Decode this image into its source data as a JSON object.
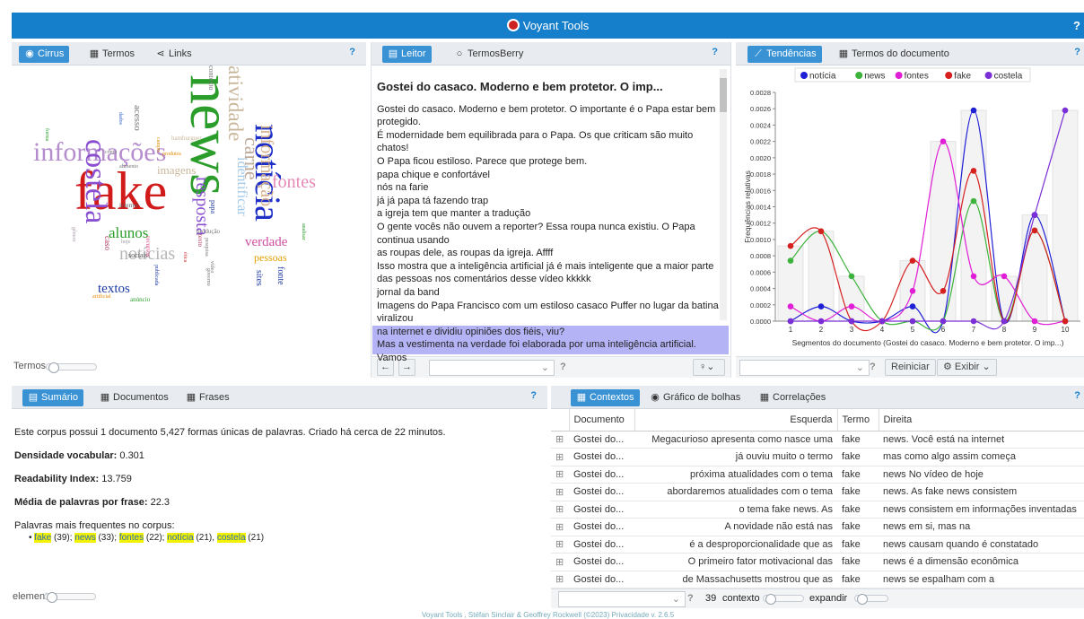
{
  "app": {
    "title": "Voyant Tools",
    "help": "?"
  },
  "cirrus": {
    "tabs": [
      "Cirrus",
      "Termos",
      "Links"
    ],
    "help": "?",
    "footer_label": "Termos",
    "words": [
      "news",
      "fake",
      "informações",
      "costela",
      "notícia",
      "fontes",
      "atividade",
      "carne",
      "informação",
      "notícias",
      "textos",
      "resposta",
      "identificar",
      "verdade",
      "pessoas",
      "imagens",
      "alunos",
      "fonte",
      "sites",
      "acesso",
      "sociais",
      "internet",
      "conta",
      "hamburguer",
      "produção",
      "caso",
      "texto",
      "vídeo",
      "ética",
      "artificial",
      "anúncio",
      "publicada",
      "recursos",
      "pesquisa",
      "hoje",
      "contexto",
      "analisar",
      "campo",
      "gênero",
      "produtos",
      "alimento",
      "governo",
      "dados",
      "forma",
      "papa"
    ]
  },
  "reader": {
    "tabs": [
      "Leitor",
      "TermosBerry"
    ],
    "help": "?",
    "title": "Gostei do casaco. Moderno e bem protetor. O imp...",
    "lines": [
      "Gostei do casaco. Moderno e bem protetor. O importante é o Papa estar bem",
      "protegido.",
      "É modernidade bem equilibrada para o Papa. Os que criticam são muito chatos!",
      "O Papa ficou estiloso. Parece que protege bem.",
      "papa chique e confortável",
      "nós na farie",
      "já já papa tá fazendo trap",
      "a igreja tem que manter a tradução",
      "O gente vocês não ouvem a reporter? Essa roupa nunca existiu. O Papa",
      "continua usando",
      "as roupas dele, as roupas da igreja. Affff",
      "Isso mostra que a inteligência artificial já é mais inteligente que a maior parte",
      "das pessoas nos comentários desse vídeo kkkkk",
      "jornal da band",
      "Imagens do Papa Francisco com um estiloso casaco Puffer no lugar da batina",
      "viralizou",
      "na internet e dividiu opiniões dos fiéis, viu?",
      "Mas a vestimenta na verdade foi elaborada por uma inteligência artificial. Vamos"
    ],
    "help_small": "?"
  },
  "trends": {
    "tabs": [
      "Tendências",
      "Termos do documento"
    ],
    "help": "?",
    "reset_label": "Reiniciar",
    "show_label": "Exibir",
    "combo_help": "?"
  },
  "chart_data": {
    "type": "line",
    "ylabel": "Frequências relativas",
    "xlabel": "Segmentos do documento (Gostei do casaco. Moderno e bem protetor. O imp...)",
    "x": [
      1,
      2,
      3,
      4,
      5,
      6,
      7,
      8,
      9,
      10
    ],
    "ylim": [
      0,
      0.0028
    ],
    "yticks": [
      "0.0000",
      "0.0002",
      "0.0004",
      "0.0006",
      "0.0008",
      "0.0010",
      "0.0012",
      "0.0014",
      "0.0016",
      "0.0018",
      "0.0020",
      "0.0022",
      "0.0024",
      "0.0026",
      "0.0028"
    ],
    "legend_position": "top",
    "series": [
      {
        "name": "notícia",
        "color": "#1f1fd6",
        "values": [
          0.0,
          0.00018,
          0.0,
          0.0,
          0.00018,
          0.0,
          0.00258,
          0.0,
          0.0013,
          0.0
        ]
      },
      {
        "name": "news",
        "color": "#3db33d",
        "values": [
          0.00074,
          0.0011,
          0.00055,
          0.0,
          0.0,
          0.0,
          0.00147,
          0.0,
          0.00111,
          0.0
        ]
      },
      {
        "name": "fontes",
        "color": "#e01ed6",
        "values": [
          0.00018,
          0.0,
          0.00018,
          0.0,
          0.00037,
          0.0022,
          0.00055,
          0.00055,
          0.0,
          0.0
        ]
      },
      {
        "name": "fake",
        "color": "#d62020",
        "values": [
          0.00092,
          0.0011,
          0.0,
          0.0,
          0.00074,
          0.00037,
          0.00184,
          0.0,
          0.00111,
          0.0
        ]
      },
      {
        "name": "costela",
        "color": "#7b2fd6",
        "values": [
          0.0,
          0.0,
          0.0,
          0.0,
          0.0,
          0.0,
          0.0,
          0.0,
          0.0013,
          0.00258
        ]
      }
    ]
  },
  "summary": {
    "tabs": [
      "Sumário",
      "Documentos",
      "Frases"
    ],
    "help": "?",
    "intro": "Este corpus possui 1 documento 5,427 formas únicas de palavras. Criado há cerca de 22 minutos.",
    "density_label": "Densidade vocabular:",
    "density_value": "0.301",
    "readability_label": "Readability Index:",
    "readability_value": "13.759",
    "avg_label": "Média de palavras por frase:",
    "avg_value": "22.3",
    "freq_label": "Palavras mais frequentes no corpus:",
    "freq": [
      {
        "w": "fake",
        "c": "(39)"
      },
      {
        "w": "news",
        "c": "(33)"
      },
      {
        "w": "fontes",
        "c": "(22)"
      },
      {
        "w": "notícia",
        "c": "(21)"
      },
      {
        "w": "costela",
        "c": "(21)"
      }
    ],
    "footer_label": "element"
  },
  "contexts": {
    "tabs": [
      "Contextos",
      "Gráfico de bolhas",
      "Correlações"
    ],
    "help": "?",
    "columns": [
      "Documento",
      "Esquerda",
      "Termo",
      "Direita"
    ],
    "rows": [
      [
        "Gostei do...",
        "Megacurioso apresenta como nasce uma",
        "fake",
        "news. Você está na internet"
      ],
      [
        "Gostei do...",
        "já ouviu muito o termo",
        "fake",
        "mas como algo assim começa"
      ],
      [
        "Gostei do...",
        "próxima atualidades com o tema",
        "fake",
        "news No vídeo de hoje"
      ],
      [
        "Gostei do...",
        "abordaremos atualidades com o tema",
        "fake",
        "news. As fake news consistem"
      ],
      [
        "Gostei do...",
        "o tema fake news. As",
        "fake",
        "news consistem em informações inventadas"
      ],
      [
        "Gostei do...",
        "A novidade não está nas",
        "fake",
        "news em si, mas na"
      ],
      [
        "Gostei do...",
        "é a desproporcionalidade que as",
        "fake",
        "news causam quando é constatado"
      ],
      [
        "Gostei do...",
        "O primeiro fator motivacional das",
        "fake",
        "news é a dimensão econômica"
      ],
      [
        "Gostei do...",
        "de Massachusetts mostrou que as",
        "fake",
        "news se espalham com a"
      ]
    ],
    "count": "39",
    "context_label": "contexto",
    "expand_label": "expandir",
    "combo_help": "?"
  },
  "footer": {
    "text": "Voyant Tools , Stéfan Sinclair & Geoffrey Rockwell (©2023) Privacidade v. 2.6.5"
  }
}
